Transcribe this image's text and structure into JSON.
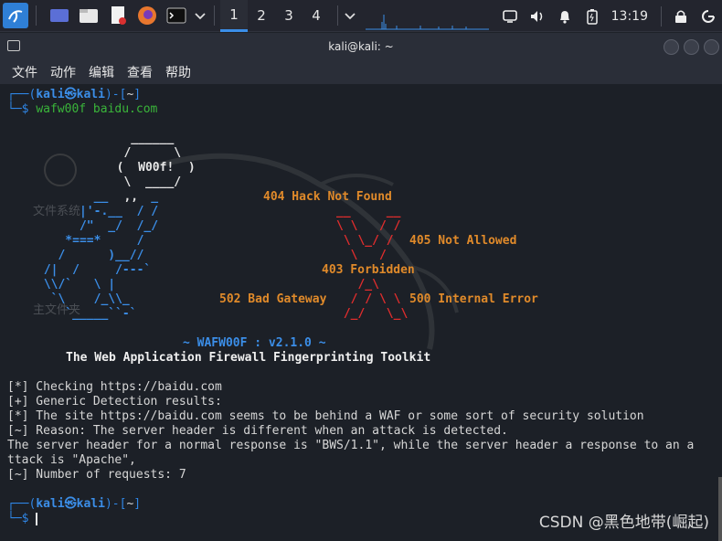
{
  "taskbar": {
    "workspaces": [
      "1",
      "2",
      "3",
      "4"
    ],
    "active_workspace": "1",
    "clock": "13:19",
    "icons": [
      "kali-menu-icon",
      "desktop-icon",
      "file-manager-icon",
      "text-editor-icon",
      "firefox-icon",
      "terminal-icon"
    ]
  },
  "window": {
    "title": "kali@kali: ~"
  },
  "menu": [
    "文件",
    "动作",
    "编辑",
    "查看",
    "帮助"
  ],
  "desktop": {
    "labels": [
      "文件系统",
      "主文件夹"
    ]
  },
  "terminal": {
    "prompt1": {
      "user": "kali",
      "host": "kali",
      "path": "~",
      "command": "wafw00f baidu.com"
    },
    "art": {
      "logo_text": "W00f!",
      "errors": {
        "e404": "404 Hack Not Found",
        "e405": "405 Not Allowed",
        "e403": "403 Forbidden",
        "e502": "502 Bad Gateway",
        "e500": "500 Internal Error"
      }
    },
    "banner_version": "~ WAFW00F : v2.1.0 ~",
    "banner_subtitle": "The Web Application Firewall Fingerprinting Toolkit",
    "output": [
      "[*] Checking https://baidu.com",
      "[+] Generic Detection results:",
      "[*] The site https://baidu.com seems to be behind a WAF or some sort of security solution",
      "[~] Reason: The server header is different when an attack is detected.",
      "The server header for a normal response is \"BWS/1.1\", while the server header a response to an a",
      "ttack is \"Apache\",",
      "[~] Number of requests: 7"
    ],
    "prompt2": {
      "user": "kali",
      "host": "kali",
      "path": "~"
    }
  },
  "watermark": "CSDN @黑色地带(崛起)"
}
